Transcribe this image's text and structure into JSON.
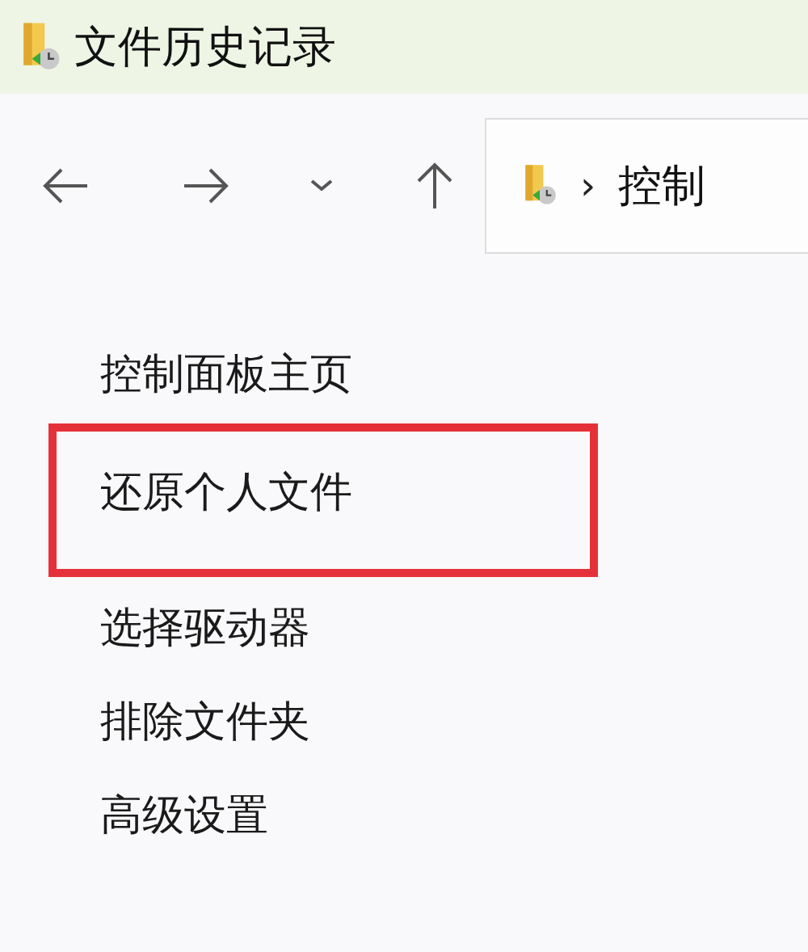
{
  "window": {
    "title": "文件历史记录"
  },
  "address_bar": {
    "separator": "›",
    "path": "控制"
  },
  "sidebar": {
    "items": [
      {
        "label": "控制面板主页",
        "highlighted": false
      },
      {
        "label": "还原个人文件",
        "highlighted": true
      },
      {
        "label": "选择驱动器",
        "highlighted": false
      },
      {
        "label": "排除文件夹",
        "highlighted": false
      },
      {
        "label": "高级设置",
        "highlighted": false
      }
    ]
  }
}
